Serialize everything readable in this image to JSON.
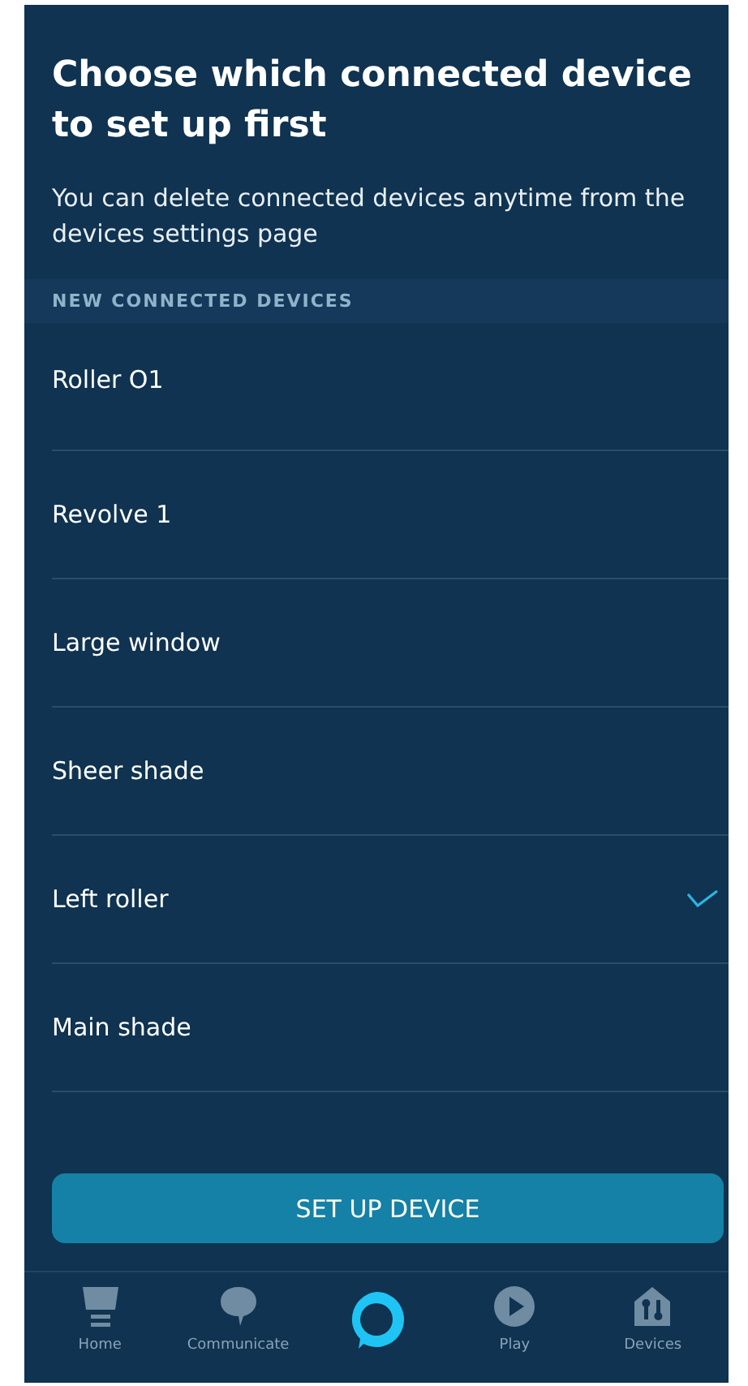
{
  "title": "Choose which connected device to set up first",
  "subtitle": "You can delete connected devices anytime from the devices settings page",
  "section_header": "NEW CONNECTED DEVICES",
  "devices": [
    {
      "name": "Roller O1",
      "selected": false
    },
    {
      "name": "Revolve 1",
      "selected": false
    },
    {
      "name": "Large window",
      "selected": false
    },
    {
      "name": "Sheer shade",
      "selected": false
    },
    {
      "name": "Left roller",
      "selected": true
    },
    {
      "name": "Main shade",
      "selected": false
    }
  ],
  "primary_button": "SET UP DEVICE",
  "nav": [
    {
      "kind": "home",
      "label": "Home"
    },
    {
      "kind": "communicate",
      "label": "Communicate"
    },
    {
      "kind": "alexa"
    },
    {
      "kind": "play",
      "label": "Play"
    },
    {
      "kind": "devices",
      "label": "Devices"
    }
  ]
}
